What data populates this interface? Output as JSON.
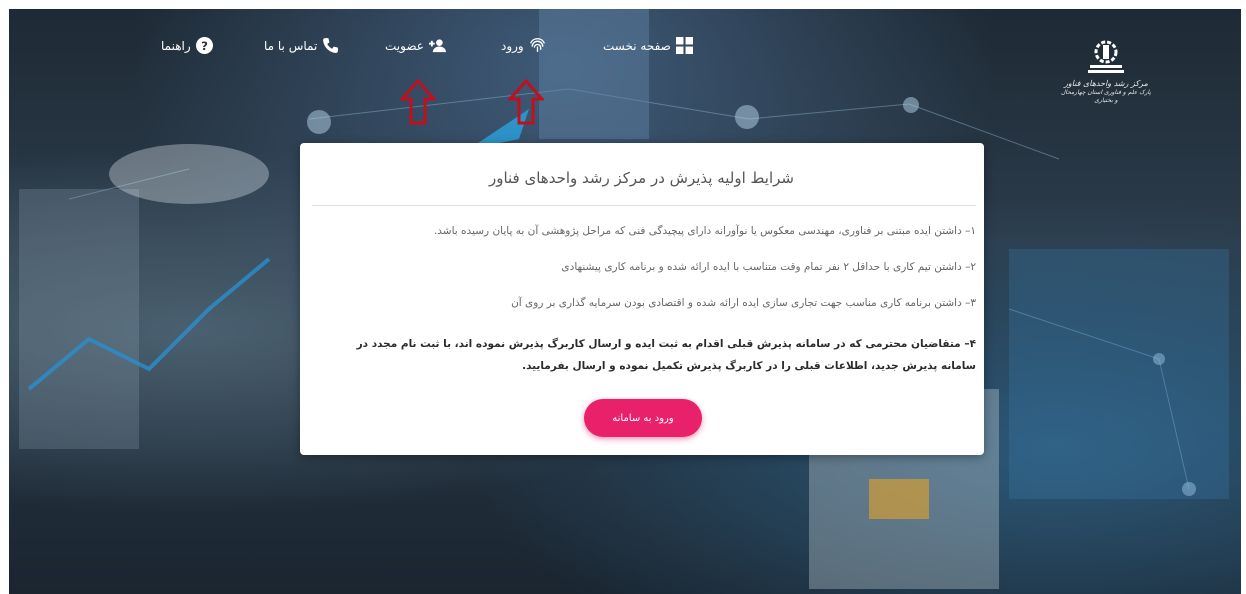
{
  "nav": {
    "home": "صفحه نخست",
    "login": "ورود",
    "membership": "عضویت",
    "contact": "تماس با ما",
    "help": "راهنما"
  },
  "logo": {
    "line1": "مرکز رشد واحدهای فناور",
    "line2": "پارک علم و فناوری استان چهارمحال و بختیاری"
  },
  "card": {
    "title": "شرایط اولیه پذیرش در مرکز رشد واحدهای فناور",
    "conditions": [
      "۱– داشتن ایده مبتنی بر فناوری، مهندسی معکوس یا نوآورانه دارای پیچیدگی فنی که مراحل پژوهشی آن به پایان رسیده باشد.",
      "۲– داشتن تیم کاری با حداقل ۲ نفر تمام وقت متناسب با ایده ارائه شده و برنامه کاری پیشنهادی",
      "۳– داشتن برنامه کاری مناسب جهت تجاری سازی ایده ارائه شده و اقتصادی بودن سرمایه گذاری بر روی آن",
      "۴– متقاضیان محترمی که در سامانه پذیرش قبلی اقدام به ثبت ایده و ارسال کاربرگ پذیرش نموده اند، با ثبت نام مجدد در سامانه پذیرش جدید، اطلاعات قبلی را در کاربرگ پذیرش تکمیل نموده و ارسال بفرمایید."
    ],
    "button": "ورود به سامانه"
  },
  "colors": {
    "accent": "#e8216a",
    "arrow": "#c0101e"
  },
  "icons": {
    "home": "grid-icon",
    "login": "fingerprint-icon",
    "membership": "user-plus-icon",
    "contact": "phone-icon",
    "help": "question-circle-icon"
  }
}
